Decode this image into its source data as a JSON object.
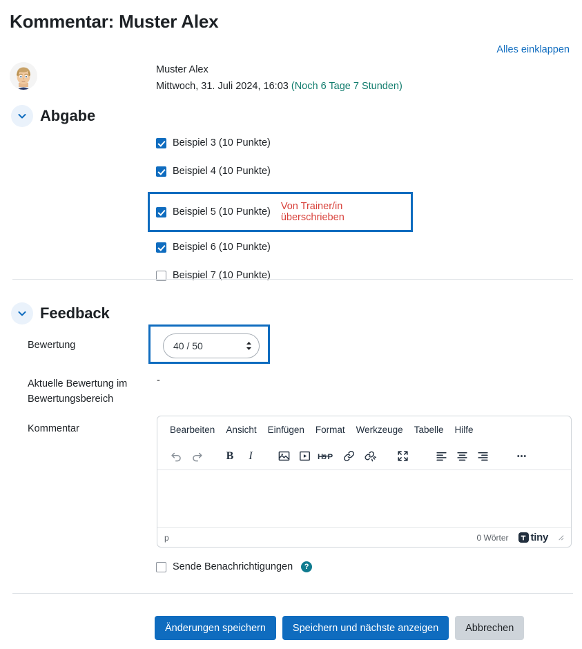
{
  "page": {
    "title": "Kommentar: Muster Alex",
    "collapse_all_label": "Alles einklappen"
  },
  "colors": {
    "accent_blue": "#0f6cbf",
    "highlight_border": "#0f6cbf",
    "danger_red": "#d8403a",
    "time_left_teal": "#0f7b6c",
    "help_teal": "#0f7b8f",
    "secondary_grey": "#ced4da"
  },
  "user": {
    "avatar_name": "user-avatar",
    "name": "Muster Alex",
    "date_text": "Mittwoch, 31. Juli 2024, 16:03",
    "time_left": "(Noch 6 Tage 7 Stunden)"
  },
  "sections": {
    "abgabe": {
      "title": "Abgabe",
      "chevron": "chevron-down-icon",
      "items": [
        {
          "label": "Beispiel 3 (10 Punkte)",
          "checked": true,
          "highlighted": false,
          "note": ""
        },
        {
          "label": "Beispiel 4 (10 Punkte)",
          "checked": true,
          "highlighted": false,
          "note": ""
        },
        {
          "label": "Beispiel 5 (10 Punkte)",
          "checked": true,
          "highlighted": true,
          "note": "Von Trainer/in überschrieben"
        },
        {
          "label": "Beispiel 6 (10 Punkte)",
          "checked": true,
          "highlighted": false,
          "note": ""
        },
        {
          "label": "Beispiel 7 (10 Punkte)",
          "checked": false,
          "highlighted": false,
          "note": ""
        }
      ]
    },
    "feedback": {
      "title": "Feedback",
      "chevron": "chevron-down-icon",
      "grade": {
        "label": "Bewertung",
        "value": "40 / 50",
        "spinner": "spinner-up-down-icon"
      },
      "current_grade": {
        "label": "Aktuelle Bewertung im Bewertungsbereich",
        "value": "-"
      },
      "comment": {
        "label": "Kommentar",
        "editor": {
          "menu": [
            "Bearbeiten",
            "Ansicht",
            "Einfügen",
            "Format",
            "Werkzeuge",
            "Tabelle",
            "Hilfe"
          ],
          "toolbar": [
            {
              "name": "undo-icon",
              "label": ""
            },
            {
              "name": "redo-icon",
              "label": ""
            },
            {
              "name": "bold-icon",
              "label": "B"
            },
            {
              "name": "italic-icon",
              "label": "I"
            },
            {
              "name": "image-icon",
              "label": ""
            },
            {
              "name": "media-icon",
              "label": ""
            },
            {
              "name": "h5p-icon",
              "label": "H-P"
            },
            {
              "name": "link-icon",
              "label": ""
            },
            {
              "name": "unlink-icon",
              "label": ""
            },
            {
              "name": "fullscreen-icon",
              "label": ""
            },
            {
              "name": "align-left-icon",
              "label": ""
            },
            {
              "name": "align-center-icon",
              "label": ""
            },
            {
              "name": "align-right-icon",
              "label": ""
            },
            {
              "name": "more-icon",
              "label": ""
            }
          ],
          "content": "",
          "status_path": "p",
          "word_count": "0 Wörter",
          "brand": "tiny",
          "resize_handle": "resize-handle-icon"
        }
      },
      "notify": {
        "label": "Sende Benachrichtigungen",
        "checked": false,
        "help_icon_label": "?"
      }
    }
  },
  "actions": {
    "save_changes": "Änderungen speichern",
    "save_and_next": "Speichern und nächste anzeigen",
    "cancel": "Abbrechen"
  }
}
